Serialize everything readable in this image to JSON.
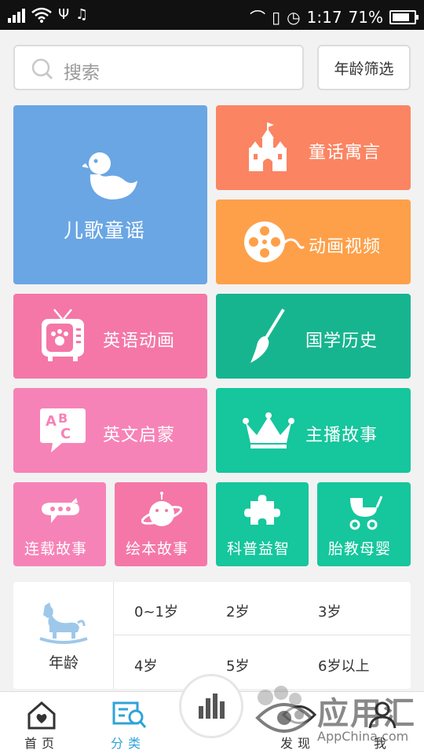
{
  "status_bar": {
    "time": "1:17",
    "battery": "71%",
    "battery_level": 0.71
  },
  "search": {
    "placeholder": "搜索",
    "age_filter_label": "年龄筛选"
  },
  "categories": {
    "nursery_rhymes": {
      "label": "儿歌童谣",
      "color": "#6aa6e4",
      "icon": "duck-icon"
    },
    "fairy_tales": {
      "label": "童话寓言",
      "color": "#fb8462",
      "icon": "castle-icon"
    },
    "animation": {
      "label": "动画视频",
      "color": "#fea04a",
      "icon": "film-reel-icon"
    },
    "english_cartoon": {
      "label": "英语动画",
      "color": "#f477a7",
      "icon": "tv-icon"
    },
    "chinese_history": {
      "label": "国学历史",
      "color": "#17b58f",
      "icon": "brush-icon"
    },
    "english_enlightenment": {
      "label": "英文启蒙",
      "color": "#f683b7",
      "icon": "abc-bubble-icon"
    },
    "host_stories": {
      "label": "主播故事",
      "color": "#16c69d",
      "icon": "crown-icon"
    },
    "serial_stories": {
      "label": "连载故事",
      "color": "#f683b7",
      "icon": "airplane-icon"
    },
    "picture_books": {
      "label": "绘本故事",
      "color": "#f477a7",
      "icon": "planet-icon"
    },
    "science": {
      "label": "科普益智",
      "color": "#16c69d",
      "icon": "puzzle-icon"
    },
    "prenatal": {
      "label": "胎教母婴",
      "color": "#16c69d",
      "icon": "stroller-icon"
    }
  },
  "age_panel": {
    "title": "年龄",
    "options": [
      "0~1岁",
      "2岁",
      "3岁",
      "4岁",
      "5岁",
      "6岁以上"
    ]
  },
  "bottom_nav": {
    "home": "首页",
    "category": "分类",
    "discover": "发现",
    "me": "我",
    "active_color": "#2fa3d8"
  },
  "watermark": {
    "text": "应用汇",
    "url": "AppChina.com"
  }
}
